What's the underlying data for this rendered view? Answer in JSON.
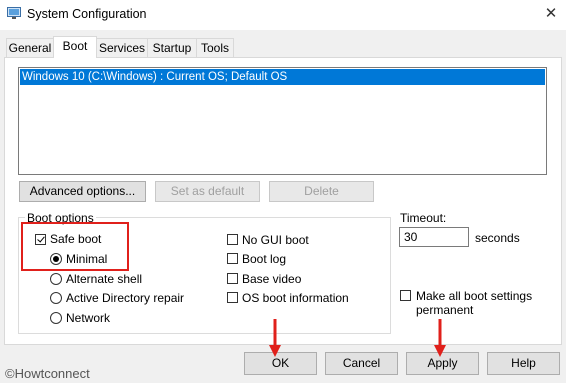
{
  "window": {
    "title": "System Configuration",
    "close_glyph": "✕"
  },
  "tabs": [
    {
      "label": "General",
      "active": false
    },
    {
      "label": "Boot",
      "active": true
    },
    {
      "label": "Services",
      "active": false
    },
    {
      "label": "Startup",
      "active": false
    },
    {
      "label": "Tools",
      "active": false
    }
  ],
  "os_list": {
    "items": [
      "Windows 10 (C:\\Windows) : Current OS; Default OS"
    ],
    "selected_index": 0
  },
  "list_buttons": {
    "advanced": "Advanced options...",
    "set_default": "Set as default",
    "delete": "Delete"
  },
  "boot_options": {
    "legend": "Boot options",
    "safe_boot": {
      "label": "Safe boot",
      "checked": true
    },
    "radios": {
      "minimal": {
        "label": "Minimal",
        "checked": true
      },
      "alternate_shell": {
        "label": "Alternate shell",
        "checked": false
      },
      "active_directory_repair": {
        "label": "Active Directory repair",
        "checked": false
      },
      "network": {
        "label": "Network",
        "checked": false
      }
    },
    "no_gui_boot": {
      "label": "No GUI boot",
      "checked": false
    },
    "boot_log": {
      "label": "Boot log",
      "checked": false
    },
    "base_video": {
      "label": "Base video",
      "checked": false
    },
    "os_boot_information": {
      "label": "OS boot information",
      "checked": false
    }
  },
  "timeout": {
    "label": "Timeout:",
    "value": "30",
    "unit": "seconds"
  },
  "make_permanent": {
    "label_line1": "Make all boot settings",
    "label_line2": "permanent",
    "checked": false
  },
  "footer": {
    "ok": "OK",
    "cancel": "Cancel",
    "apply": "Apply",
    "help": "Help"
  },
  "watermark": "©Howtconnect",
  "colors": {
    "selection": "#0078d7",
    "annotation_red": "#e0201b"
  }
}
